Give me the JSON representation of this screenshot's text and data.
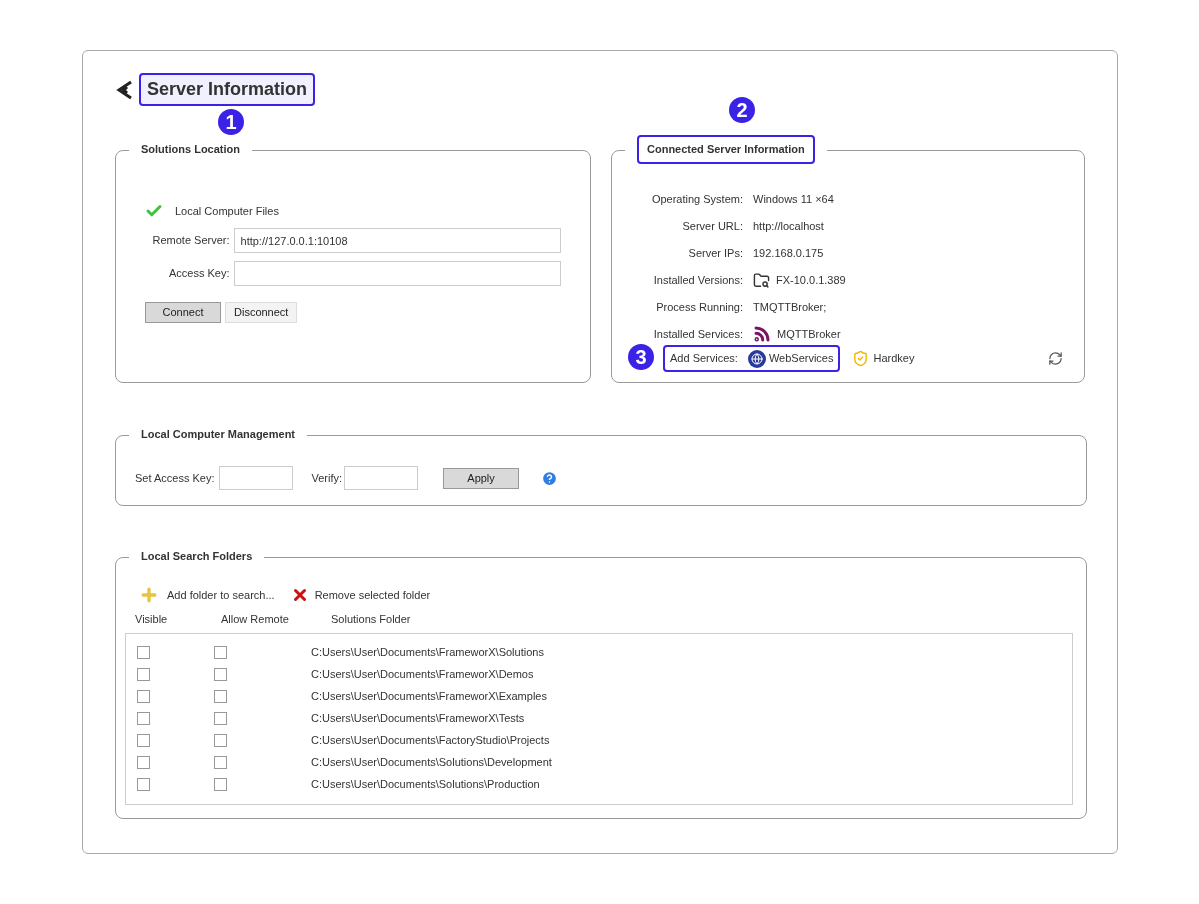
{
  "title": "Server Information",
  "callouts": [
    "1",
    "2",
    "3"
  ],
  "solutions_location": {
    "legend": "Solutions Location",
    "local_files": {
      "label": "Local Computer Files",
      "checked": true
    },
    "fields": [
      {
        "label": "Remote Server:",
        "value": "http://127.0.0.1:10108"
      },
      {
        "label": "Access Key:"
      }
    ],
    "buttons": [
      {
        "label": "Connect",
        "pressed": true
      },
      {
        "label": "Disconnect",
        "pressed": false
      }
    ]
  },
  "connected_server": {
    "legend": "Connected Server Information",
    "rows": [
      {
        "label": "Operating System:",
        "value": "Windows 11 ×64",
        "kind": "text"
      },
      {
        "label": "Server URL:",
        "value": "http://localhost",
        "kind": "text"
      },
      {
        "label": "Server IPs:",
        "value": "192.168.0.175",
        "kind": "text"
      },
      {
        "label": "Installed Versions:",
        "value": "FX-10.0.1.389",
        "kind": "folder"
      },
      {
        "label": "Process Running:",
        "value": "TMQTTBroker;",
        "kind": "text"
      },
      {
        "label": "Installed Services:",
        "value": "MQTTBroker",
        "kind": "feed"
      }
    ],
    "add_services": {
      "label": "Add Services:",
      "service": "WebServices",
      "extra": "Hardkey"
    }
  },
  "local_management": {
    "legend": "Local Computer Management",
    "set_key_label": "Set Access Key:",
    "verify_label": "Verify:",
    "apply": "Apply"
  },
  "search_folders": {
    "legend": "Local Search Folders",
    "add": "Add folder to search...",
    "remove": "Remove selected folder",
    "columns": [
      "Visible",
      "Allow Remote",
      "Solutions Folder"
    ],
    "rows": [
      {
        "visible": false,
        "remote": false,
        "path": "C:Users\\User\\Documents\\FrameworX\\Solutions"
      },
      {
        "visible": false,
        "remote": false,
        "path": "C:Users\\User\\Documents\\FrameworX\\Demos"
      },
      {
        "visible": false,
        "remote": false,
        "path": "C:Users\\User\\Documents\\FrameworX\\Examples"
      },
      {
        "visible": false,
        "remote": false,
        "path": "C:Users\\User\\Documents\\FrameworX\\Tests"
      },
      {
        "visible": false,
        "remote": false,
        "path": "C:Users\\User\\Documents\\FactoryStudio\\Projects"
      },
      {
        "visible": false,
        "remote": false,
        "path": "C:Users\\User\\Documents\\Solutions\\Development"
      },
      {
        "visible": false,
        "remote": false,
        "path": "C:Users\\User\\Documents\\Solutions\\Production"
      }
    ]
  }
}
